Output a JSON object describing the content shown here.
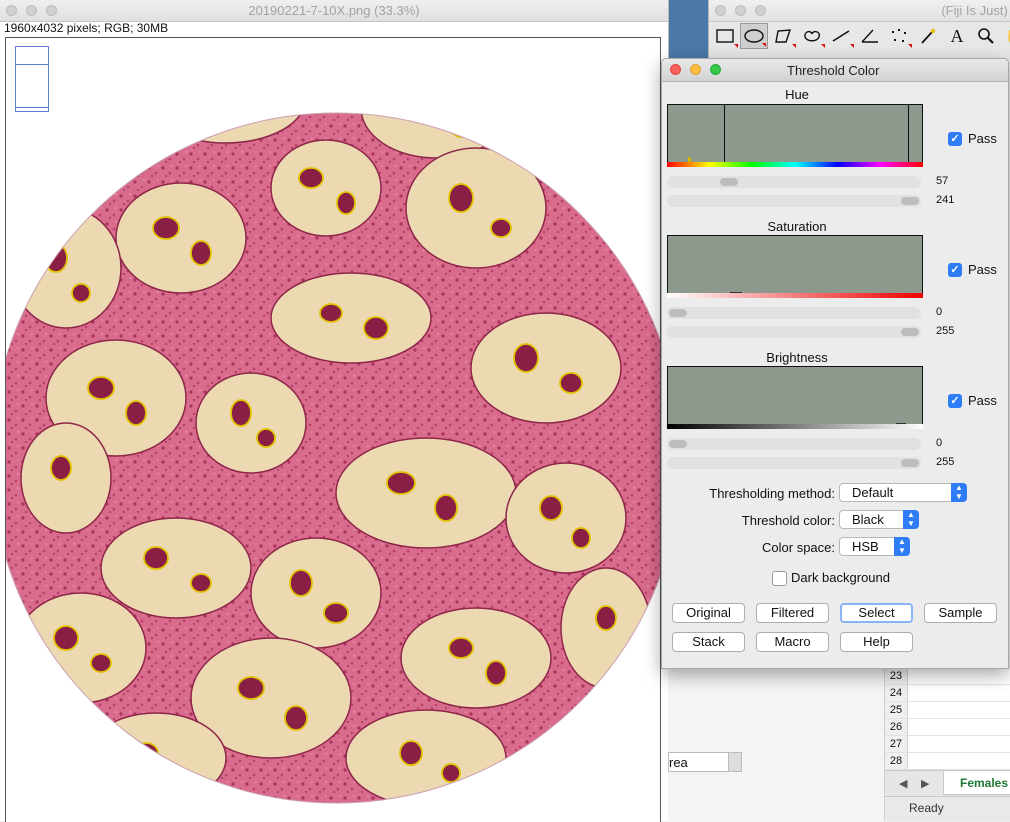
{
  "image_window": {
    "title": "20190221-7-10X.png (33.3%)",
    "info": "1960x4032 pixels; RGB; 30MB"
  },
  "toolbar": {
    "title": "(Fiji Is Just) I",
    "tools": [
      "rectangle-tool-icon",
      "oval-tool-icon",
      "polygon-tool-icon",
      "freehand-tool-icon",
      "line-tool-icon",
      "angle-tool-icon",
      "point-tool-icon",
      "wand-tool-icon",
      "text-tool-icon",
      "magnifier-tool-icon",
      "hand-tool-icon"
    ]
  },
  "dialog": {
    "title": "Threshold Color",
    "hue": {
      "title": "Hue",
      "pass_label": "Pass",
      "min": "57",
      "max": "241",
      "min_frac": 0.22,
      "max_frac": 1.0
    },
    "saturation": {
      "title": "Saturation",
      "pass_label": "Pass",
      "min": "0",
      "max": "255",
      "min_frac": 0.0,
      "max_frac": 1.0
    },
    "brightness": {
      "title": "Brightness",
      "pass_label": "Pass",
      "min": "0",
      "max": "255",
      "min_frac": 0.0,
      "max_frac": 1.0
    },
    "method_label": "Thresholding method:",
    "method_value": "Default",
    "color_label": "Threshold color:",
    "color_value": "Black",
    "space_label": "Color space:",
    "space_value": "HSB",
    "dark_label": "Dark background",
    "buttons": [
      "Original",
      "Filtered",
      "Select",
      "Sample",
      "Stack",
      "Macro",
      "Help"
    ]
  },
  "results": {
    "column_header": "rea"
  },
  "sheet": {
    "rows": [
      "23",
      "24",
      "25",
      "26",
      "27",
      "28"
    ],
    "tab_label": "Females",
    "status": "Ready"
  },
  "colors": {
    "accent": "#2f7df6",
    "hist_bg": "#8e998e",
    "tab_green": "#1f7a35"
  }
}
